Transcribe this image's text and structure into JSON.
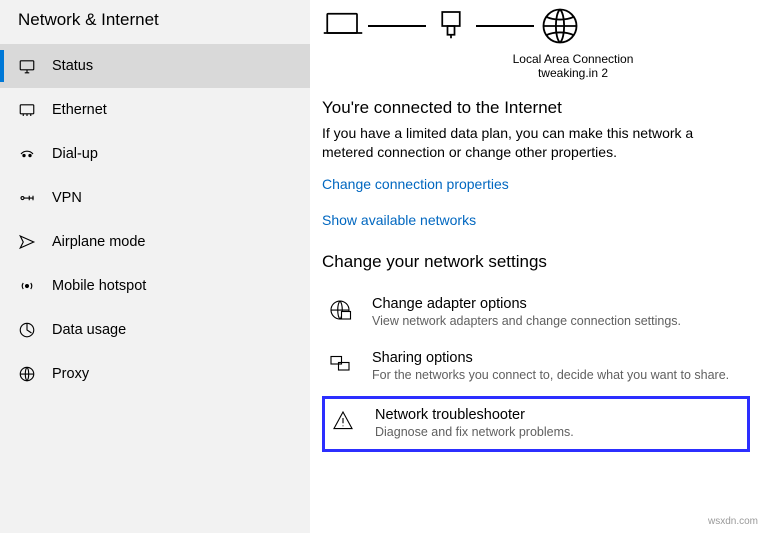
{
  "sidebar": {
    "title": "Network & Internet",
    "items": [
      {
        "label": "Status"
      },
      {
        "label": "Ethernet"
      },
      {
        "label": "Dial-up"
      },
      {
        "label": "VPN"
      },
      {
        "label": "Airplane mode"
      },
      {
        "label": "Mobile hotspot"
      },
      {
        "label": "Data usage"
      },
      {
        "label": "Proxy"
      }
    ]
  },
  "diagram": {
    "caption1": "Local Area Connection",
    "caption2": "tweaking.in 2"
  },
  "status": {
    "heading": "You're connected to the Internet",
    "desc": "If you have a limited data plan, you can make this network a metered connection or change other properties.",
    "link1": "Change connection properties",
    "link2": "Show available networks"
  },
  "settings": {
    "heading": "Change your network settings",
    "items": [
      {
        "title": "Change adapter options",
        "sub": "View network adapters and change connection settings."
      },
      {
        "title": "Sharing options",
        "sub": "For the networks you connect to, decide what you want to share."
      },
      {
        "title": "Network troubleshooter",
        "sub": "Diagnose and fix network problems."
      }
    ]
  },
  "watermark": "wsxdn.com"
}
